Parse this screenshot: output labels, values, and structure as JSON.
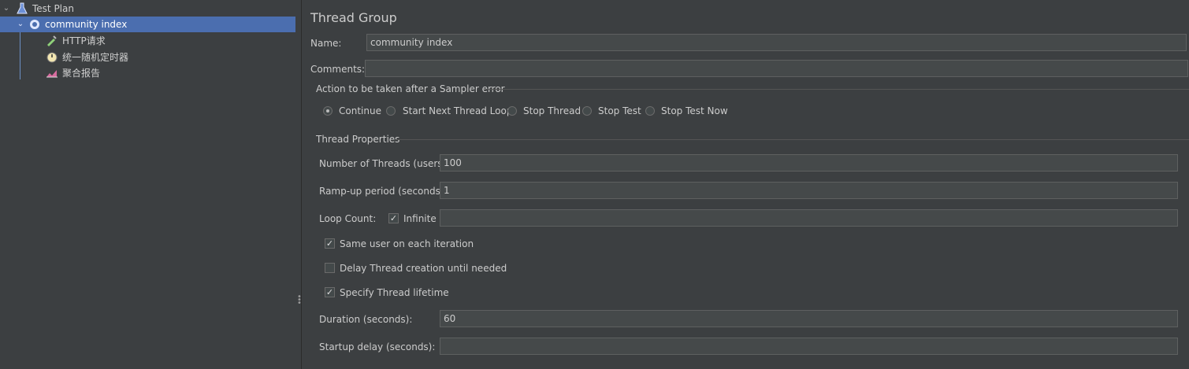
{
  "tree": {
    "test_plan": "Test Plan",
    "thread_group": "community index",
    "children": [
      "HTTP请求",
      "统一随机定时器",
      "聚合报告"
    ]
  },
  "panel": {
    "title": "Thread Group",
    "name_label": "Name:",
    "name_value": "community index",
    "comments_label": "Comments:",
    "comments_value": "",
    "error_section": "Action to be taken after a Sampler error",
    "error_options": [
      "Continue",
      "Start Next Thread Loop",
      "Stop Thread",
      "Stop Test",
      "Stop Test Now"
    ],
    "error_selected": "Continue",
    "thread_section": "Thread Properties",
    "threads_label": "Number of Threads (users):",
    "threads_value": "100",
    "rampup_label": "Ramp-up period (seconds):",
    "rampup_value": "1",
    "loop_label": "Loop Count:",
    "infinite_label": "Infinite",
    "loop_value": "",
    "same_user_label": "Same user on each iteration",
    "delay_label": "Delay Thread creation until needed",
    "lifetime_label": "Specify Thread lifetime",
    "duration_label": "Duration (seconds):",
    "duration_value": "60",
    "startup_label": "Startup delay (seconds):",
    "startup_value": ""
  },
  "colors": {
    "background": "#3c3f41",
    "selection": "#4b6eaf",
    "field": "#45494a"
  }
}
